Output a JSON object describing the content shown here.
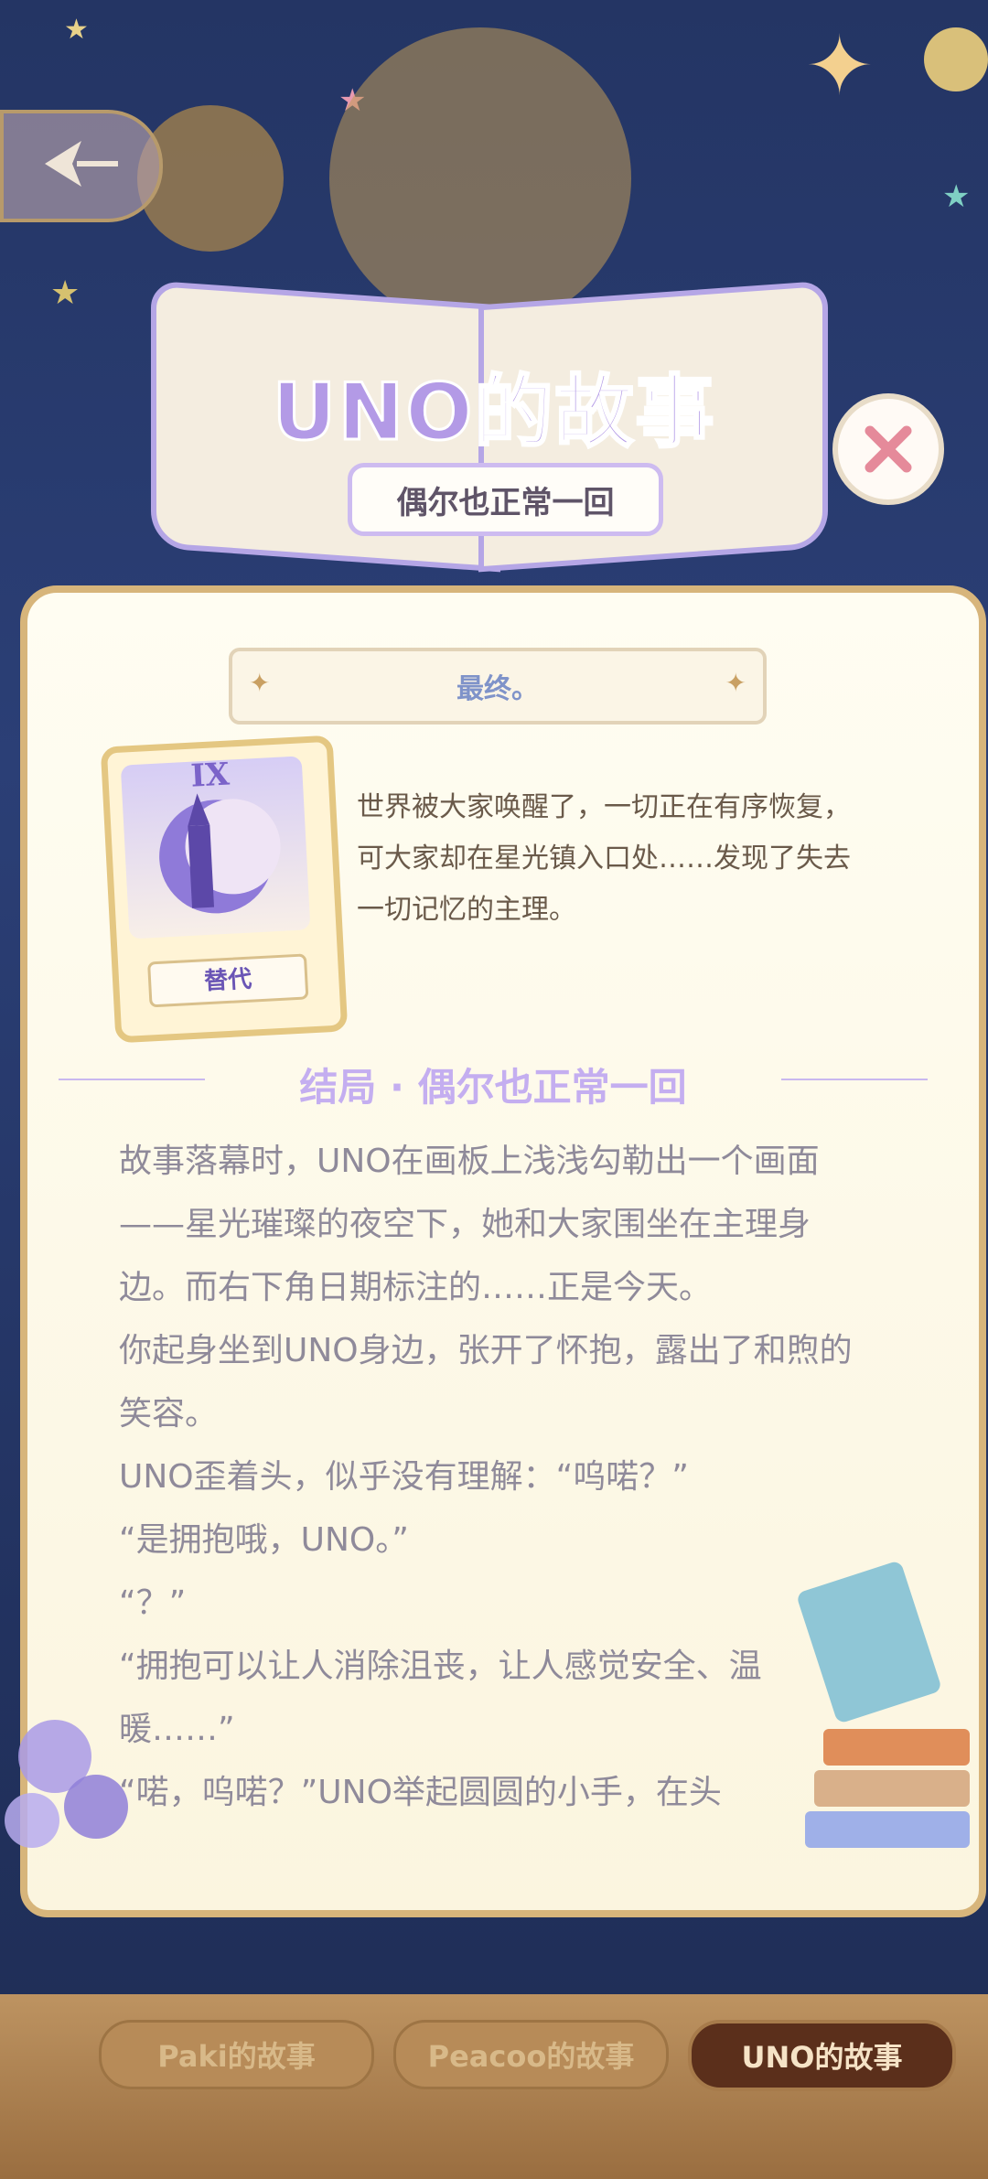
{
  "header": {
    "title": "UNO的故事",
    "subtitle": "偶尔也正常一回"
  },
  "chapter": {
    "banner": "最终。",
    "card_label": "替代",
    "card_roman": "IX",
    "summary": "世界被大家唤醒了，一切正在有序恢复，可大家却在星光镇入口处……发现了失去一切记忆的主理。"
  },
  "ending": {
    "heading": "结局 · 偶尔也正常一回",
    "paragraphs": [
      "故事落幕时，UNO在画板上浅浅勾勒出一个画面——星光璀璨的夜空下，她和大家围坐在主理身边。而右下角日期标注的……正是今天。",
      "你起身坐到UNO身边，张开了怀抱，露出了和煦的笑容。",
      "UNO歪着头，似乎没有理解：“呜喏？”",
      "“是拥抱哦，UNO。”",
      "“？”",
      "“拥抱可以让人消除沮丧，让人感觉安全、温暖……”",
      "“喏，呜喏？”UNO举起圆圆的小手，在头"
    ]
  },
  "tabs": [
    {
      "label": "Paki的故事",
      "active": false
    },
    {
      "label": "Peacoo的故事",
      "active": false
    },
    {
      "label": "UNO的故事",
      "active": true
    }
  ],
  "colors": {
    "accent_purple": "#b39ae6",
    "active_tab": "#5b2f1b",
    "panel_border": "#d7b57b"
  }
}
